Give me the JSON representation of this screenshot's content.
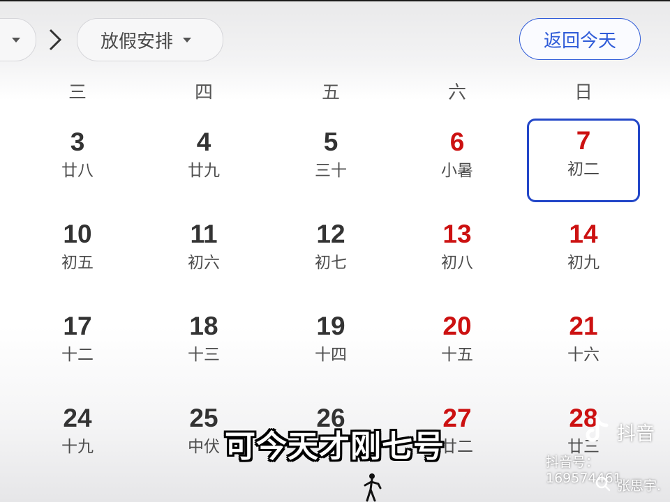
{
  "toolbar": {
    "holiday_label": "放假安排",
    "today_label": "返回今天"
  },
  "weekdays": [
    "三",
    "四",
    "五",
    "六",
    "日"
  ],
  "weeks": [
    [
      {
        "day": "3",
        "lunar": "廿八"
      },
      {
        "day": "4",
        "lunar": "廿九"
      },
      {
        "day": "5",
        "lunar": "三十"
      },
      {
        "day": "6",
        "lunar": "小暑"
      },
      {
        "day": "7",
        "lunar": "初二"
      }
    ],
    [
      {
        "day": "10",
        "lunar": "初五"
      },
      {
        "day": "11",
        "lunar": "初六"
      },
      {
        "day": "12",
        "lunar": "初七"
      },
      {
        "day": "13",
        "lunar": "初八"
      },
      {
        "day": "14",
        "lunar": "初九"
      }
    ],
    [
      {
        "day": "17",
        "lunar": "十二"
      },
      {
        "day": "18",
        "lunar": "十三"
      },
      {
        "day": "19",
        "lunar": "十四"
      },
      {
        "day": "20",
        "lunar": "十五"
      },
      {
        "day": "21",
        "lunar": "十六"
      }
    ],
    [
      {
        "day": "24",
        "lunar": "十九"
      },
      {
        "day": "25",
        "lunar": "中伏"
      },
      {
        "day": "26",
        "lunar": ""
      },
      {
        "day": "27",
        "lunar": "廿二"
      },
      {
        "day": "28",
        "lunar": "廿三"
      }
    ]
  ],
  "selected_day": "7",
  "colors": {
    "accent": "#2f5bd8",
    "selected_border": "#2347c8",
    "weekend": "#cc1111",
    "weekday_number": "#333333"
  },
  "overlay": {
    "subtitle": "可今天才刚七号",
    "watermark_name": "抖音",
    "watermark_id": "抖音号：169574461",
    "author": "张思宇."
  }
}
